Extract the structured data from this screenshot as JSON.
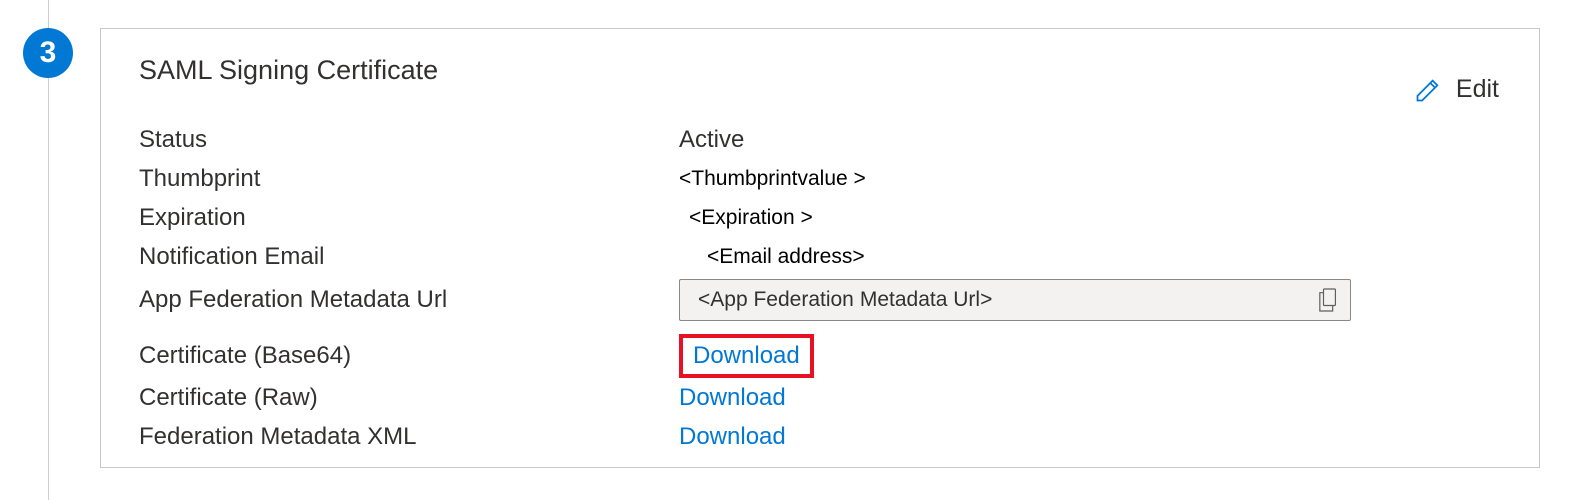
{
  "step": {
    "number": "3"
  },
  "card": {
    "title": "SAML Signing Certificate",
    "edit_label": "Edit",
    "rows": {
      "status": {
        "label": "Status",
        "value": "Active"
      },
      "thumbprint": {
        "label": "Thumbprint",
        "value": "<Thumbprintvalue >"
      },
      "expiration": {
        "label": "Expiration",
        "value": "<Expiration >"
      },
      "notification_email": {
        "label": "Notification Email",
        "value": "<Email address>"
      },
      "app_federation_url": {
        "label": "App Federation Metadata Url",
        "value_prefix": "<App Federation",
        "value_suffix": "Metadata Url>"
      },
      "cert_base64": {
        "label": "Certificate (Base64)",
        "link": "Download"
      },
      "cert_raw": {
        "label": "Certificate (Raw)",
        "link": "Download"
      },
      "fed_xml": {
        "label": "Federation Metadata XML",
        "link": "Download"
      }
    }
  }
}
